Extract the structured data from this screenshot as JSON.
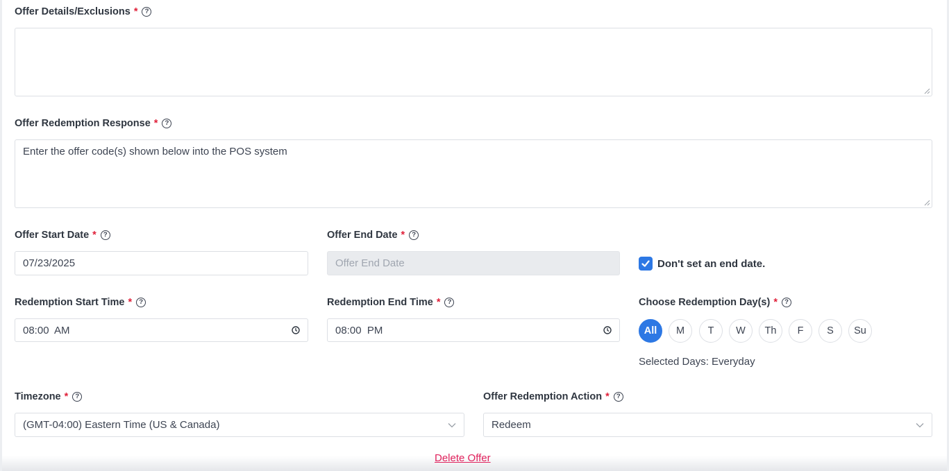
{
  "offer_details": {
    "label": "Offer Details/Exclusions",
    "required": "*",
    "value": ""
  },
  "redemption_response": {
    "label": "Offer Redemption Response",
    "required": "*",
    "value": "Enter the offer code(s) shown below into the POS system"
  },
  "start_date": {
    "label": "Offer Start Date",
    "required": "*",
    "value": "07/23/2025"
  },
  "end_date": {
    "label": "Offer End Date",
    "required": "*",
    "placeholder": "Offer End Date",
    "value": ""
  },
  "no_end_date": {
    "label": "Don't set an end date.",
    "checked": true
  },
  "start_time": {
    "label": "Redemption Start Time",
    "required": "*",
    "value": "08:00  AM"
  },
  "end_time": {
    "label": "Redemption End Time",
    "required": "*",
    "value": "08:00  PM"
  },
  "days": {
    "label": "Choose Redemption Day(s)",
    "required": "*",
    "options": [
      "All",
      "M",
      "T",
      "W",
      "Th",
      "F",
      "S",
      "Su"
    ],
    "selected": "All",
    "summary": "Selected Days: Everyday"
  },
  "timezone": {
    "label": "Timezone",
    "required": "*",
    "value": "(GMT-04:00) Eastern Time (US & Canada)"
  },
  "redemption_action": {
    "label": "Offer Redemption Action",
    "required": "*",
    "value": "Redeem"
  },
  "delete_link": "Delete Offer",
  "help_glyph": "?",
  "colors": {
    "accent": "#2d78e4",
    "required": "#e0213a",
    "danger_link": "#e0215c"
  }
}
